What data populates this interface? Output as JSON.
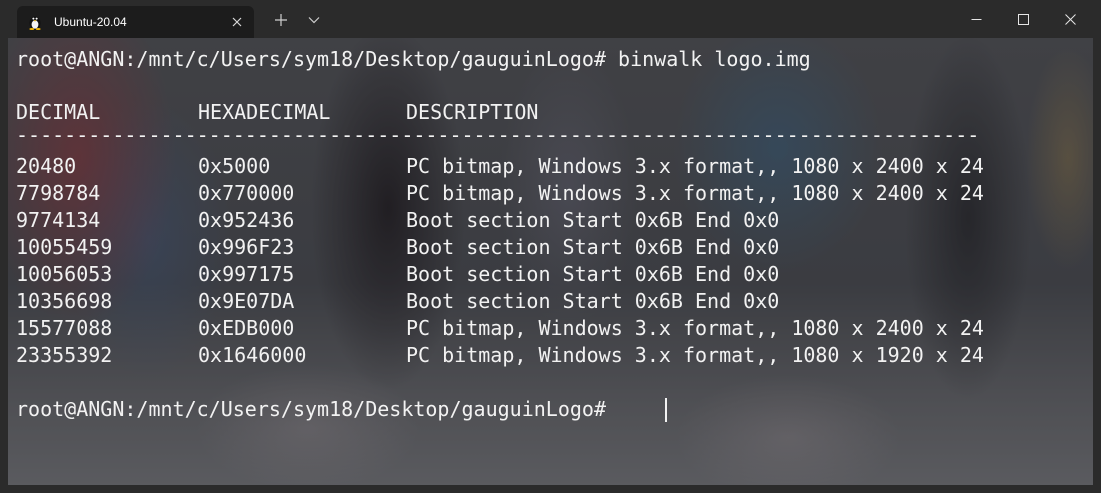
{
  "window": {
    "tab_title": "Ubuntu-20.04",
    "tab_icon": "linux-penguin-icon",
    "new_tab_symbol": "+",
    "dropdown_icon": "chevron-down-icon",
    "controls": [
      "minimize-icon",
      "maximize-icon",
      "close-icon"
    ]
  },
  "terminal": {
    "command_line": "root@ANGN:/mnt/c/Users/sym18/Desktop/gauguinLogo# binwalk logo.img",
    "headers": [
      "DECIMAL",
      "HEXADECIMAL",
      "DESCRIPTION"
    ],
    "separator": "--------------------------------------------------------------------------------",
    "rows": [
      {
        "decimal": "20480",
        "hex": "0x5000",
        "description": "PC bitmap, Windows 3.x format,, 1080 x 2400 x 24"
      },
      {
        "decimal": "7798784",
        "hex": "0x770000",
        "description": "PC bitmap, Windows 3.x format,, 1080 x 2400 x 24"
      },
      {
        "decimal": "9774134",
        "hex": "0x952436",
        "description": "Boot section Start 0x6B End 0x0"
      },
      {
        "decimal": "10055459",
        "hex": "0x996F23",
        "description": "Boot section Start 0x6B End 0x0"
      },
      {
        "decimal": "10056053",
        "hex": "0x997175",
        "description": "Boot section Start 0x6B End 0x0"
      },
      {
        "decimal": "10356698",
        "hex": "0x9E07DA",
        "description": "Boot section Start 0x6B End 0x0"
      },
      {
        "decimal": "15577088",
        "hex": "0xEDB000",
        "description": "PC bitmap, Windows 3.x format,, 1080 x 2400 x 24"
      },
      {
        "decimal": "23355392",
        "hex": "0x1646000",
        "description": "PC bitmap, Windows 3.x format,, 1080 x 1920 x 24"
      }
    ],
    "prompt": "root@ANGN:/mnt/c/Users/sym18/Desktop/gauguinLogo#"
  },
  "colors": {
    "terminal_text": "#f2f2f2",
    "titlebar_bg": "#2b2b2b",
    "active_tab_bg": "#1c1c1c"
  }
}
